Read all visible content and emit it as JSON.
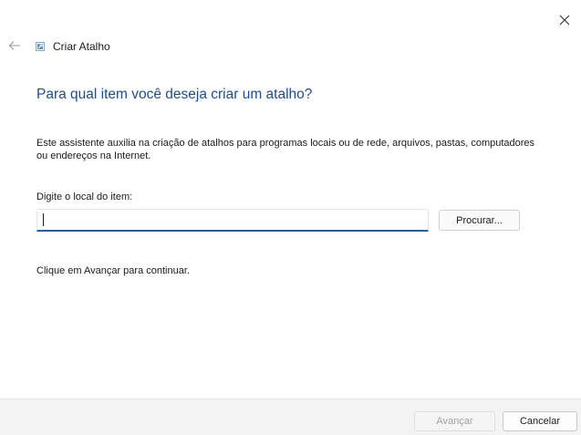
{
  "window": {
    "title": "Criar Atalho",
    "close_icon": "close-icon",
    "back_icon": "back-arrow-icon",
    "app_icon": "shortcut-icon"
  },
  "main": {
    "heading": "Para qual item você deseja criar um atalho?",
    "description": "Este assistente auxilia na criação de atalhos para programas locais ou de rede, arquivos, pastas, computadores ou endereços na Internet.",
    "location_label": "Digite o local do item:",
    "location_value": "",
    "browse_label": "Procurar...",
    "continue_hint": "Clique em Avançar para continuar."
  },
  "footer": {
    "next_label": "Avançar",
    "next_enabled": false,
    "cancel_label": "Cancelar"
  },
  "colors": {
    "heading": "#1d4d8c",
    "input_focus_border": "#1f5fae",
    "footer_bg": "#f3f3f3",
    "disabled_text": "#a0a0a0"
  }
}
